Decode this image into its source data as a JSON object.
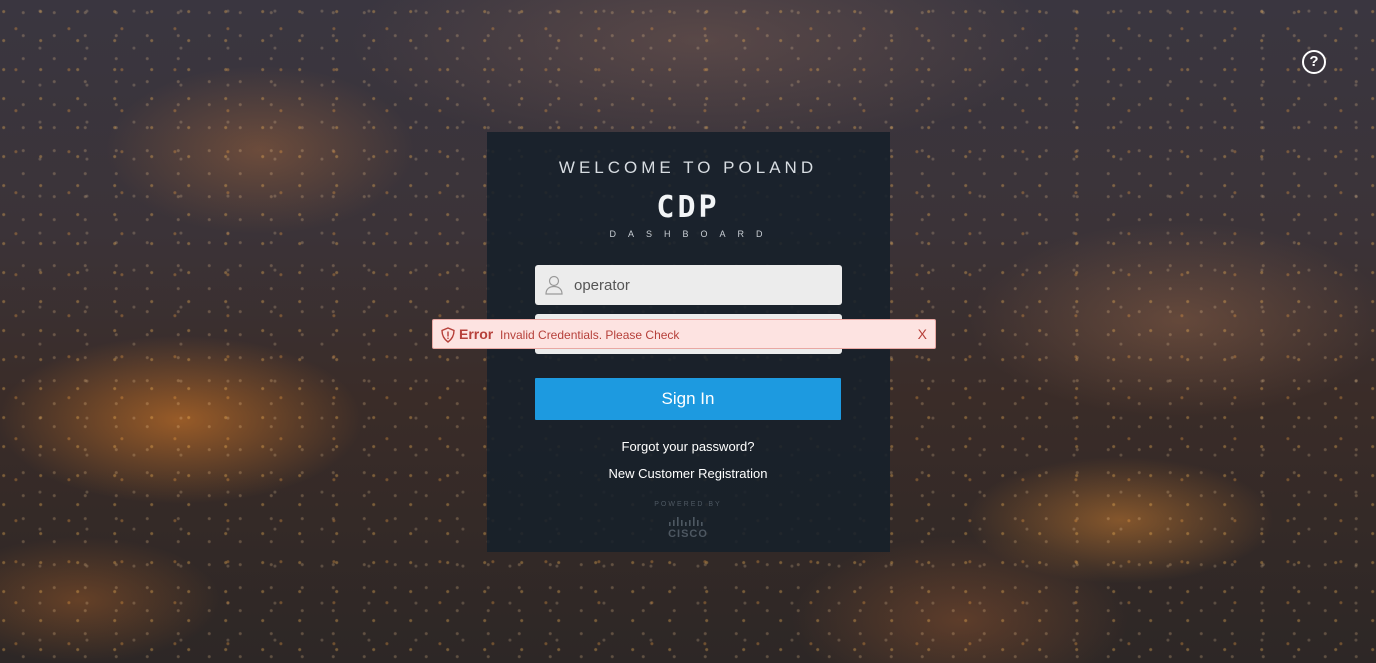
{
  "help": {
    "icon": "help-circle-icon",
    "symbol": "?"
  },
  "panel": {
    "welcome": "WELCOME TO POLAND",
    "logo_title": "CDP",
    "logo_subtitle": "DASHBOARD"
  },
  "form": {
    "username_value": "operator",
    "username_icon": "user-icon",
    "password_value": "",
    "signin_label": "Sign In",
    "forgot_label": "Forgot your password?",
    "register_label": "New Customer Registration"
  },
  "error": {
    "icon": "shield-alert-icon",
    "title": "Error",
    "message": "Invalid Credentials. Please Check",
    "close": "X",
    "color": "#b6403a",
    "background": "#fde3e1"
  },
  "footer": {
    "powered_by": "POWERED BY",
    "brand": "CISCO"
  },
  "colors": {
    "accent": "#1d9ae0",
    "panel": "#16202a"
  }
}
